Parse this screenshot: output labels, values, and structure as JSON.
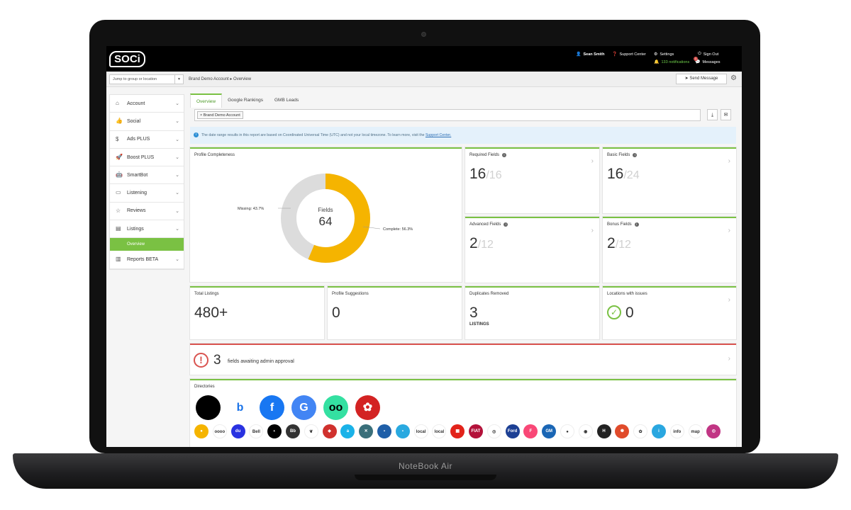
{
  "device": {
    "label": "NoteBook Air"
  },
  "topbar": {
    "logo": "SOCi",
    "user": "Sean Smith",
    "support": "Support Center",
    "settings": "Settings",
    "notifications": "133 notifications",
    "signout": "Sign Out",
    "messages": "Messages",
    "messages_badge": "1"
  },
  "crumbbar": {
    "jump_placeholder": "Jump to group or location",
    "breadcrumb": "Brand Demo Account ▸ Overview",
    "send_message": "Send Message"
  },
  "sidebar": {
    "items": [
      {
        "label": "Account",
        "icon": "home-icon"
      },
      {
        "label": "Social",
        "icon": "thumbs-up-icon"
      },
      {
        "label": "Ads PLUS",
        "icon": "dollar-icon"
      },
      {
        "label": "Boost PLUS",
        "icon": "rocket-icon"
      },
      {
        "label": "SmartBot",
        "icon": "robot-icon"
      },
      {
        "label": "Listening",
        "icon": "chat-icon"
      },
      {
        "label": "Reviews",
        "icon": "star-icon"
      },
      {
        "label": "Listings",
        "icon": "listings-icon"
      },
      {
        "label": "Reports BETA",
        "icon": "bar-chart-icon"
      }
    ],
    "sub_active": "Overview"
  },
  "tabs": [
    "Overview",
    "Google Rankings",
    "GMB Leads"
  ],
  "filter": {
    "chip": "Brand Demo Account"
  },
  "info": {
    "text": "The date range results in this report are based on Coordinated Universal Time (UTC) and not your local timezone. To learn more, visit the",
    "link": "Support Center."
  },
  "cards": {
    "profile_title": "Profile Completeness",
    "donut_center_label": "Fields",
    "donut_center_value": "64",
    "complete_pct": 56.3,
    "missing_pct": 43.7,
    "complete_label": "Complete: 56.3%",
    "missing_label": "Missing: 43.7%",
    "complete_color": "#f5b400",
    "missing_color": "#dcdcdc",
    "required": {
      "title": "Required Fields",
      "value": "16",
      "total": "/16"
    },
    "basic": {
      "title": "Basic Fields",
      "value": "16",
      "total": "/24"
    },
    "advanced": {
      "title": "Advanced Fields",
      "value": "2",
      "total": "/12"
    },
    "bonus": {
      "title": "Bonus Fields",
      "value": "2",
      "total": "/12"
    },
    "total_listings": {
      "title": "Total Listings",
      "value": "480+"
    },
    "suggestions": {
      "title": "Profile Suggestions",
      "value": "0"
    },
    "duplicates": {
      "title": "Duplicates Removed",
      "value": "3",
      "unit": "LISTINGS"
    },
    "issues": {
      "title": "Locations with issues",
      "value": "0"
    }
  },
  "alert": {
    "count": "3",
    "text": "fields awaiting admin approval"
  },
  "directories": {
    "title": "Directories",
    "big": [
      {
        "name": "apple-icon",
        "glyph": "",
        "color": "#000000"
      },
      {
        "name": "bing-icon",
        "glyph": "b",
        "color": "#ffffff"
      },
      {
        "name": "facebook-icon",
        "glyph": "f",
        "color": "#1877f2"
      },
      {
        "name": "google-business-icon",
        "glyph": "G",
        "color": "#4285f4"
      },
      {
        "name": "tripadvisor-icon",
        "glyph": "oo",
        "color": "#34e0a1"
      },
      {
        "name": "yelp-icon",
        "glyph": "✿",
        "color": "#d32323"
      }
    ],
    "small": [
      {
        "name": "bulb-icon",
        "glyph": "●",
        "color": "#f5b400"
      },
      {
        "name": "audi-icon",
        "glyph": "oooo",
        "color": "#ffffff"
      },
      {
        "name": "baidu-icon",
        "glyph": "du",
        "color": "#2932e1"
      },
      {
        "name": "bell-icon",
        "glyph": "Bell",
        "color": "#ffffff"
      },
      {
        "name": "bmw-icon",
        "glyph": "◐",
        "color": "#000000"
      },
      {
        "name": "bb-icon",
        "glyph": "Bb",
        "color": "#333333"
      },
      {
        "name": "leaf-icon",
        "glyph": "❦",
        "color": "#ffffff"
      },
      {
        "name": "bird-icon",
        "glyph": "◆",
        "color": "#d0312d"
      },
      {
        "name": "a-icon",
        "glyph": "a",
        "color": "#1ab2e8"
      },
      {
        "name": "x-icon",
        "glyph": "✕",
        "color": "#3a6f7a"
      },
      {
        "name": "blue-icon",
        "glyph": "▪",
        "color": "#1f5fa8"
      },
      {
        "name": "cyan-icon",
        "glyph": "▪",
        "color": "#29a9e0"
      },
      {
        "name": "local-icon",
        "glyph": "local",
        "color": "#ffffff"
      },
      {
        "name": "ilocal-icon",
        "glyph": "local",
        "color": "#ffffff"
      },
      {
        "name": "grid-icon",
        "glyph": "▦",
        "color": "#e2231a"
      },
      {
        "name": "fiat-icon",
        "glyph": "FIAT",
        "color": "#b3123a"
      },
      {
        "name": "pin-icon",
        "glyph": "◎",
        "color": "#ffffff"
      },
      {
        "name": "ford-icon",
        "glyph": "Ford",
        "color": "#1c3f94"
      },
      {
        "name": "foursquare-icon",
        "glyph": "F",
        "color": "#f94877"
      },
      {
        "name": "gm-icon",
        "glyph": "GM",
        "color": "#1a66b5"
      },
      {
        "name": "assistant-icon",
        "glyph": "●",
        "color": "#ffffff"
      },
      {
        "name": "maps-icon",
        "glyph": "◉",
        "color": "#ffffff"
      },
      {
        "name": "hummer-icon",
        "glyph": "H",
        "color": "#222222"
      },
      {
        "name": "fish-icon",
        "glyph": "✺",
        "color": "#e04b2b"
      },
      {
        "name": "huawei-icon",
        "glyph": "✿",
        "color": "#ffffff"
      },
      {
        "name": "info-i-icon",
        "glyph": "i",
        "color": "#2aa7e0"
      },
      {
        "name": "infofeed-icon",
        "glyph": "info",
        "color": "#ffffff"
      },
      {
        "name": "map-text-icon",
        "glyph": "map",
        "color": "#ffffff"
      },
      {
        "name": "instagram-icon",
        "glyph": "◎",
        "color": "#c13584"
      }
    ]
  }
}
